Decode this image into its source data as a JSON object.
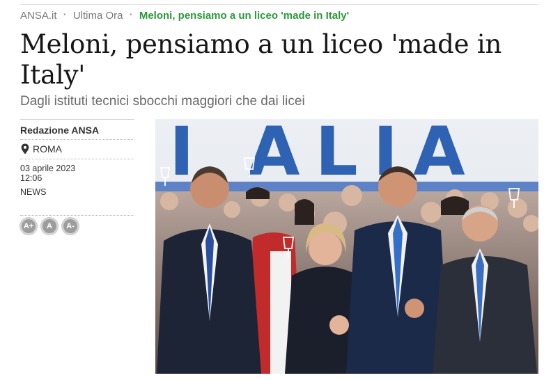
{
  "breadcrumb": {
    "items": [
      {
        "label": "ANSA.it"
      },
      {
        "label": "Ultima Ora"
      },
      {
        "label": "Meloni, pensiamo a un liceo 'made in Italy'"
      }
    ],
    "separator": "‣"
  },
  "article": {
    "title": "Meloni, pensiamo a un liceo 'made in Italy'",
    "subtitle": "Dagli istituti tecnici sbocchi maggiori che dai licei",
    "author": "Redazione ANSA",
    "location": "ROMA",
    "date": "03 aprile 2023",
    "time": "12:06",
    "category": "NEWS"
  },
  "font_controls": {
    "increase": "A+",
    "reset": "A",
    "decrease": "A-"
  },
  "photo": {
    "banner_text": "I ALIA"
  },
  "colors": {
    "breadcrumb_current": "#2a9a3a",
    "breadcrumb_link": "#7a7a7a",
    "headline": "#161616",
    "subtitle": "#6a6a6a",
    "font_button": "#9d9d9d",
    "banner_blue": "#2f62b3"
  }
}
